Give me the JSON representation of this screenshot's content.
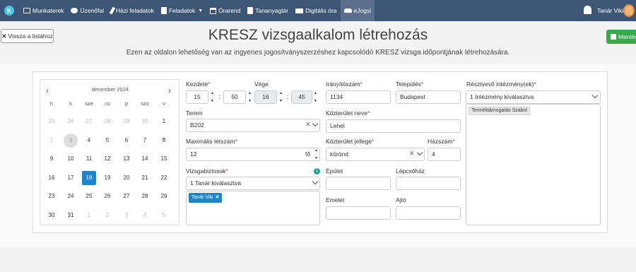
{
  "nav": {
    "logo": "K",
    "items": [
      {
        "label": "Munkaterek"
      },
      {
        "label": "Üzenőfal"
      },
      {
        "label": "Házi feladatok"
      },
      {
        "label": "Feladatok"
      },
      {
        "label": "Órarend"
      },
      {
        "label": "Tananyagtár"
      },
      {
        "label": "Digitális óra"
      },
      {
        "label": "eJogsi"
      }
    ],
    "user": "Tanár Viki"
  },
  "header": {
    "back_label": "Vissza a listához",
    "title": "KRESZ vizsgaalkalom létrehozás",
    "subtitle": "Ezen az oldalon lehetőség van az ingyenes jogosítványszerzéshez kapcsolódó KRESZ vizsga időpontjának létrehozására.",
    "save_label": "Mentés"
  },
  "calendar": {
    "title": "december 2024",
    "dow": [
      "h",
      "k",
      "sze",
      "cs",
      "p",
      "szo",
      "v"
    ],
    "weeks": [
      [
        "25",
        "26",
        "27",
        "28",
        "29",
        "30",
        "1"
      ],
      [
        "2",
        "3",
        "4",
        "5",
        "6",
        "7",
        "8"
      ],
      [
        "9",
        "10",
        "11",
        "12",
        "13",
        "14",
        "15"
      ],
      [
        "16",
        "17",
        "18",
        "19",
        "20",
        "21",
        "22"
      ],
      [
        "23",
        "24",
        "25",
        "26",
        "27",
        "28",
        "29"
      ],
      [
        "30",
        "31",
        "1",
        "2",
        "3",
        "4",
        "5"
      ]
    ]
  },
  "form": {
    "start_label": "Kezdete",
    "start_hour": "15",
    "start_min": "50",
    "end_label": "Vége",
    "end_hour": "16",
    "end_min": "45",
    "room_label": "Terem",
    "room_value": "B202",
    "max_label": "Maximális létszám",
    "max_value": "12",
    "max_suffix": "fő",
    "examiners_label": "Vizsgabiztosok",
    "examiners_selected": "1 Tanár kiválasztva",
    "examiner_tag": "Tanár Viki",
    "zip_label": "Irányítószám",
    "zip_value": "1134",
    "city_label": "Település",
    "city_value": "Budapest",
    "street_label": "Közterület neve",
    "street_value": "Lehel",
    "street_type_label": "Közterület jellege",
    "street_type_value": "körönd",
    "house_label": "Házszám",
    "house_value": "4",
    "building_label": "Épület",
    "building_value": "",
    "stair_label": "Lépcsőház",
    "stair_value": "",
    "floor_label": "Emelet",
    "floor_value": "",
    "door_label": "Ajtó",
    "door_value": "",
    "inst_label": "Résztvevő intézmény(ek)",
    "inst_selected": "1 Intézmény kiválasztva",
    "inst_tag": "Terméktámogatás Szabol"
  },
  "colors": {
    "nav_bg": "#3e5676",
    "selected": "#1a86d0",
    "save": "#3aa94a"
  }
}
